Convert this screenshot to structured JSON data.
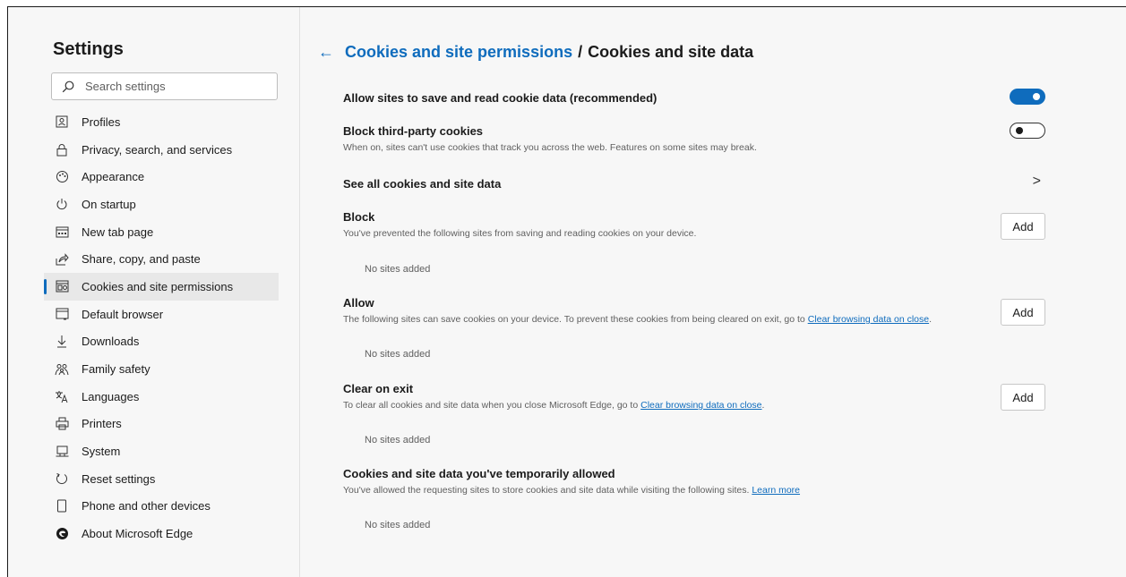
{
  "sidebar": {
    "title": "Settings",
    "search_placeholder": "Search settings",
    "items": [
      {
        "label": "Profiles",
        "icon": "profile-icon"
      },
      {
        "label": "Privacy, search, and services",
        "icon": "lock-icon"
      },
      {
        "label": "Appearance",
        "icon": "palette-icon"
      },
      {
        "label": "On startup",
        "icon": "power-icon"
      },
      {
        "label": "New tab page",
        "icon": "new-tab-icon"
      },
      {
        "label": "Share, copy, and paste",
        "icon": "share-icon"
      },
      {
        "label": "Cookies and site permissions",
        "icon": "cookies-icon",
        "active": true
      },
      {
        "label": "Default browser",
        "icon": "browser-icon"
      },
      {
        "label": "Downloads",
        "icon": "download-icon"
      },
      {
        "label": "Family safety",
        "icon": "family-icon"
      },
      {
        "label": "Languages",
        "icon": "language-icon"
      },
      {
        "label": "Printers",
        "icon": "printer-icon"
      },
      {
        "label": "System",
        "icon": "system-icon"
      },
      {
        "label": "Reset settings",
        "icon": "reset-icon"
      },
      {
        "label": "Phone and other devices",
        "icon": "phone-icon"
      },
      {
        "label": "About Microsoft Edge",
        "icon": "edge-logo-icon"
      }
    ]
  },
  "header": {
    "back_glyph": "←",
    "parent": "Cookies and site permissions",
    "separator": "/",
    "current": "Cookies and site data"
  },
  "rows": {
    "allow_cookies": {
      "title": "Allow sites to save and read cookie data (recommended)",
      "toggle_on": true
    },
    "block_third_party": {
      "title": "Block third-party cookies",
      "desc": "When on, sites can't use cookies that track you across the web. Features on some sites may break.",
      "toggle_on": false
    },
    "see_all": {
      "title": "See all cookies and site data",
      "chevron": ">"
    },
    "block": {
      "title": "Block",
      "desc": "You've prevented the following sites from saving and reading cookies on your device.",
      "button": "Add",
      "empty": "No sites added"
    },
    "allow": {
      "title": "Allow",
      "desc": "The following sites can save cookies on your device. To prevent these cookies from being cleared on exit, go to",
      "link": "Clear browsing data on close",
      "after": ".",
      "button": "Add",
      "empty": "No sites added"
    },
    "clear_on_exit": {
      "title": "Clear on exit",
      "desc": "To clear all cookies and site data when you close Microsoft Edge, go to",
      "link": "Clear browsing data on close",
      "after": ".",
      "button": "Add",
      "empty": "No sites added"
    },
    "temp_allowed": {
      "title": "Cookies and site data you've temporarily allowed",
      "desc": "You've allowed the requesting sites to store cookies and site data while visiting the following sites.",
      "link": "Learn more",
      "empty": "No sites added"
    }
  },
  "colors": {
    "accent": "#0f6cbd",
    "background": "#f7f7f7",
    "text": "#1b1b1b",
    "muted": "#5f5f5f"
  }
}
